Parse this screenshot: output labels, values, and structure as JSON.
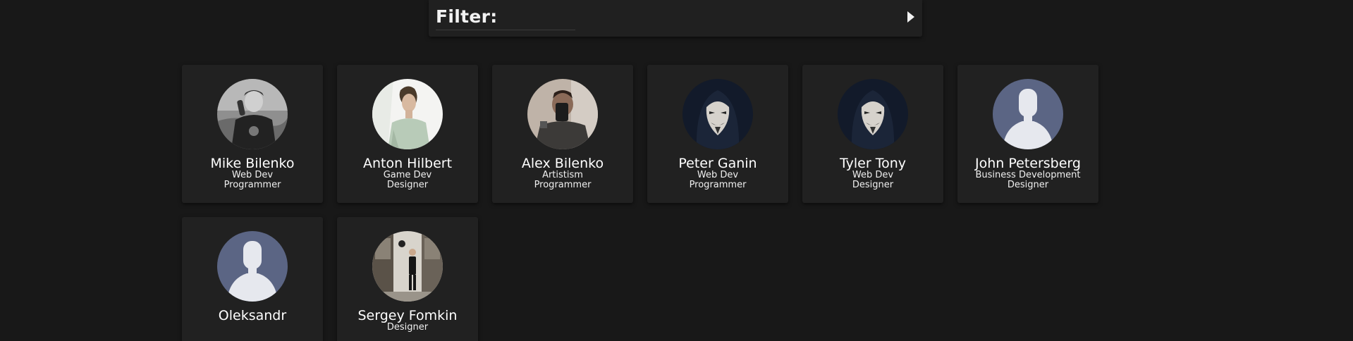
{
  "filter": {
    "label": "Filter:",
    "toggle_icon": "triangle-right-icon"
  },
  "colors": {
    "background": "#181818",
    "card": "#212121",
    "placeholder_avatar": "#5b6584"
  },
  "people": [
    {
      "name": "Mike Bilenko",
      "roles": [
        "Web Dev",
        "Programmer"
      ],
      "avatar": "photo-grayscale"
    },
    {
      "name": "Anton Hilbert",
      "roles": [
        "Game Dev",
        "Designer"
      ],
      "avatar": "photo-light"
    },
    {
      "name": "Alex Bilenko",
      "roles": [
        "Artistism",
        "Programmer"
      ],
      "avatar": "photo-mirror"
    },
    {
      "name": "Peter Ganin",
      "roles": [
        "Web Dev",
        "Programmer"
      ],
      "avatar": "photo-mask"
    },
    {
      "name": "Tyler Tony",
      "roles": [
        "Web Dev",
        "Designer"
      ],
      "avatar": "photo-mask"
    },
    {
      "name": "John Petersberg",
      "roles": [
        "Business Development",
        "Designer"
      ],
      "avatar": "placeholder"
    },
    {
      "name": "Oleksandr",
      "roles": [],
      "avatar": "placeholder"
    },
    {
      "name": "Sergey Fomkin",
      "roles": [
        "Designer"
      ],
      "avatar": "photo-street"
    }
  ]
}
